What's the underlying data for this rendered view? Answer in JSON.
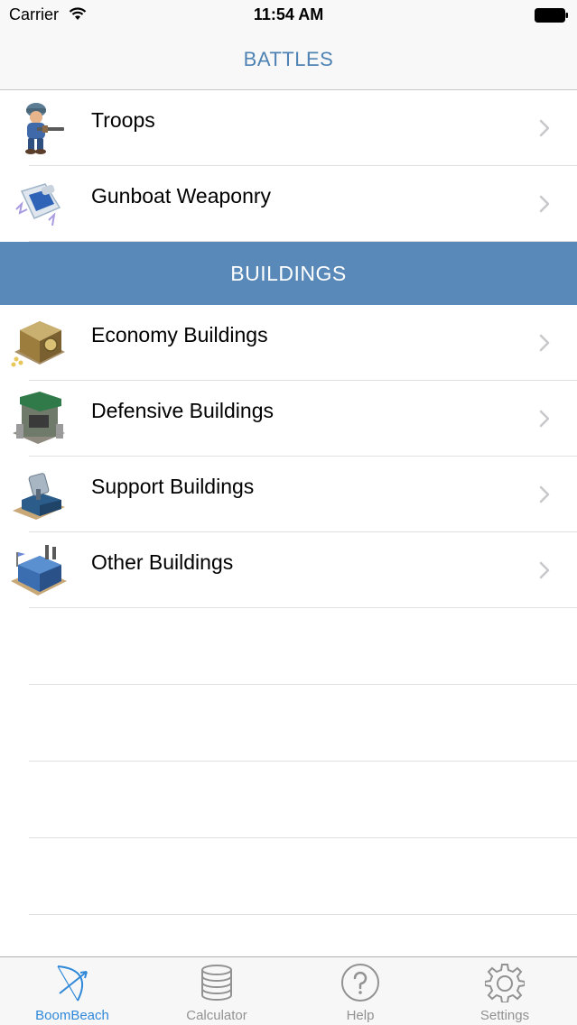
{
  "status_bar": {
    "carrier": "Carrier",
    "time": "11:54 AM"
  },
  "nav": {
    "title": "BATTLES"
  },
  "battles": {
    "items": [
      {
        "label": "Troops",
        "icon": "soldier-icon"
      },
      {
        "label": "Gunboat Weaponry",
        "icon": "gunboat-weapon-icon"
      }
    ]
  },
  "buildings": {
    "header": "BUILDINGS",
    "items": [
      {
        "label": "Economy Buildings",
        "icon": "vault-building-icon"
      },
      {
        "label": "Defensive Buildings",
        "icon": "defense-tower-icon"
      },
      {
        "label": "Support Buildings",
        "icon": "radar-building-icon"
      },
      {
        "label": "Other Buildings",
        "icon": "headquarters-icon"
      }
    ]
  },
  "tab_bar": {
    "tabs": [
      {
        "label": "BoomBeach",
        "icon": "bow-arrow-icon",
        "active": true
      },
      {
        "label": "Calculator",
        "icon": "database-icon",
        "active": false
      },
      {
        "label": "Help",
        "icon": "question-mark-icon",
        "active": false
      },
      {
        "label": "Settings",
        "icon": "gear-icon",
        "active": false
      }
    ]
  },
  "colors": {
    "accent": "#4f83b3",
    "section_header_bg": "#5989b8",
    "tab_active": "#2f88d9",
    "tab_inactive": "#929292"
  }
}
